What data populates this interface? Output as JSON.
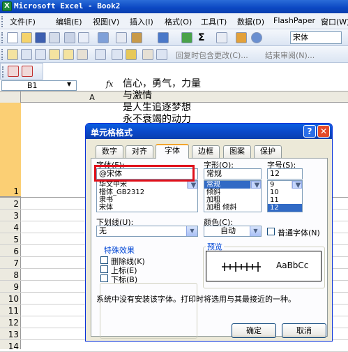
{
  "window": {
    "title": "Microsoft Excel - Book2"
  },
  "menu": [
    "文件(F)",
    "编辑(E)",
    "视图(V)",
    "插入(I)",
    "格式(O)",
    "工具(T)",
    "数据(D)",
    "FlashPaper",
    "窗口(W)"
  ],
  "toolbar": {
    "font_name": "宋体",
    "reply_with_changes": "回复时包含更改(C)...",
    "end_review": "结束审阅(N)..."
  },
  "formula_bar": {
    "name_box": "B1",
    "fx": "fx",
    "content_lines": [
      "信心，勇气，力量",
      "与激情",
      "是人生追逐梦想",
      "永不衰竭的动力"
    ]
  },
  "sheet": {
    "column_headers": [
      "A"
    ],
    "row_headers": [
      "1",
      "2",
      "3",
      "4",
      "5",
      "6",
      "7",
      "8",
      "9",
      "10",
      "11",
      "12",
      "13",
      "14"
    ]
  },
  "dialog": {
    "title": "单元格格式",
    "tabs": [
      "数字",
      "对齐",
      "字体",
      "边框",
      "图案",
      "保护"
    ],
    "active_tab": "字体",
    "font": {
      "label": "字体(F):",
      "value": "@宋体",
      "list": [
        "华文中宋",
        "楷体_GB2312",
        "隶书",
        "宋体"
      ]
    },
    "style": {
      "label": "字形(O):",
      "value": "常规",
      "list": [
        "常规",
        "倾斜",
        "加粗",
        "加粗 倾斜"
      ],
      "selected": "常规"
    },
    "size": {
      "label": "字号(S):",
      "value": "12",
      "list": [
        "9",
        "10",
        "11",
        "12"
      ],
      "selected": "12"
    },
    "underline": {
      "label": "下划线(U):",
      "value": "无"
    },
    "color": {
      "label": "颜色(C):",
      "value": "自动"
    },
    "normal_font": {
      "label": "普通字体(N)"
    },
    "effects": {
      "title": "特殊效果",
      "strikethrough": "删除线(K)",
      "superscript": "上标(E)",
      "subscript": "下标(B)"
    },
    "preview": {
      "title": "预览",
      "sample_right": "AaBbCc"
    },
    "message": "系统中没有安装该字体。打印时将选用与其最接近的一种。",
    "ok": "确定",
    "cancel": "取消"
  },
  "colors": {
    "title_bar": "#0b47c2",
    "highlight_box": "#e0101a",
    "row_header_selected": "#fbcf74",
    "selection": "#316ac5"
  }
}
